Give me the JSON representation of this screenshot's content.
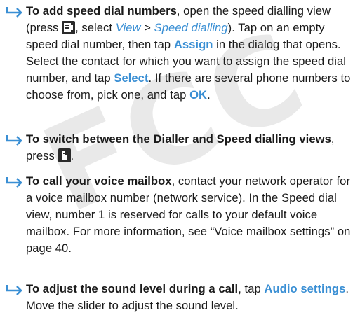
{
  "watermark": "FCC",
  "p1": {
    "heading": "To add speed dial numbers",
    "t1": ", open the speed dialling view (press ",
    "t2": ", select ",
    "menu_view": "View",
    "sep": " > ",
    "menu_speed": "Speed dialling",
    "t3": "). Tap on an empty speed dial number, then tap ",
    "assign": "Assign",
    "t4": " in the dialog that opens. Select the contact for which you want to assign the speed dial number, and tap ",
    "select": "Select",
    "t5": ". If there are several phone numbers to choose from, pick one, and tap ",
    "ok": "OK",
    "t6": "."
  },
  "p2": {
    "heading": "To switch between the Dialler and Speed dialling views",
    "t1": ", press ",
    "t2": "."
  },
  "p3": {
    "heading": "To call your voice mailbox",
    "t1": ", contact your network operator for a voice mailbox number (network service). In the Speed dial view, number 1 is reserved for calls to your default voice mailbox. For more information, see “Voice mailbox settings” on page 40."
  },
  "p4": {
    "heading": "To adjust the sound level during a call",
    "t1": ", tap ",
    "audio": "Audio settings",
    "t2": ". Move the slider to adjust the sound level."
  },
  "colors": {
    "link": "#3a8fd4",
    "arrow": "#3a8fd4",
    "text": "#1a1a1a",
    "watermark": "#e9e9e9"
  },
  "icons": [
    "right-arrow-icon",
    "menu-key-icon",
    "dialler-key-icon"
  ]
}
